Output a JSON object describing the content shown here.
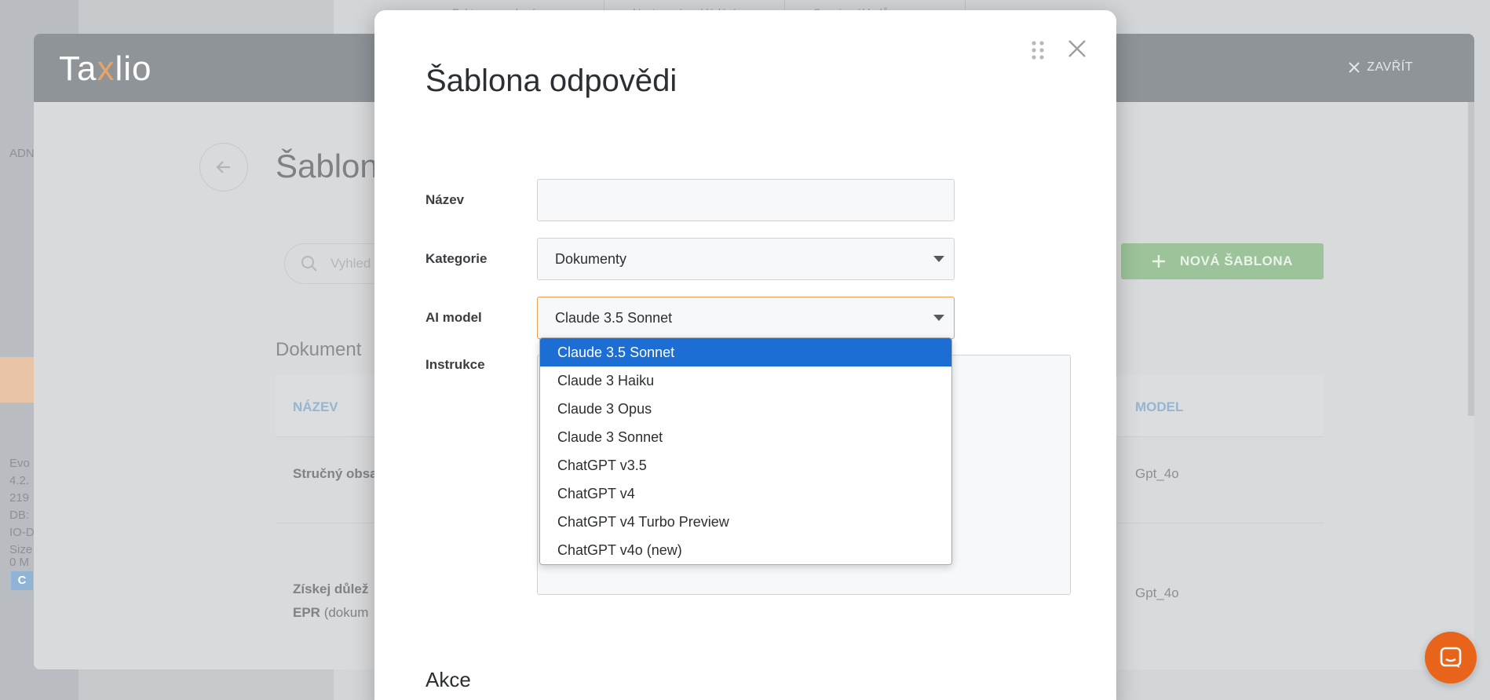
{
  "background": {
    "tabs": [
      "Faktury a vydané",
      "Nastavení a ukládání",
      "Soupis nákladů a"
    ],
    "sidebar_texts": [
      "ADN",
      "Evo",
      "4.2.",
      "219",
      "DB:",
      "IO-D",
      "Size",
      "0 M"
    ],
    "sidebar_badge": "C"
  },
  "panel": {
    "logo_pre": "Ta",
    "logo_x": "x",
    "logo_post": "lio",
    "close_label": "ZAVŘÍT",
    "title": "Šablon",
    "search_placeholder": "Vyhled",
    "new_button_label": "NOVÁ ŠABLONA",
    "section_label": "Dokument",
    "table": {
      "col_name": "NÁZEV",
      "col_model": "MODEL",
      "rows": [
        {
          "name": "Stručný obsa",
          "model": "Gpt_4o"
        },
        {
          "name_line1": "Získej důlež",
          "name_line2_bold": "EPR",
          "name_line2_rest": " (dokum",
          "model": "Gpt_4o"
        }
      ]
    }
  },
  "modal": {
    "title": "Šablona odpovědi",
    "fields": {
      "name_label": "Název",
      "name_value": "",
      "category_label": "Kategorie",
      "category_value": "Dokumenty",
      "ai_model_label": "AI model",
      "ai_model_value": "Claude 3.5 Sonnet",
      "instructions_label": "Instrukce"
    },
    "ai_model_options": [
      "Claude 3.5 Sonnet",
      "Claude 3 Haiku",
      "Claude 3 Opus",
      "Claude 3 Sonnet",
      "ChatGPT v3.5",
      "ChatGPT v4",
      "ChatGPT v4 Turbo Preview",
      "ChatGPT v4o (new)"
    ],
    "actions_heading": "Akce"
  },
  "colors": {
    "accent_orange": "#e8a054",
    "selected_blue": "#1c6ed4",
    "chat_orange": "#e8641b",
    "new_button_green": "#9cc39a"
  }
}
